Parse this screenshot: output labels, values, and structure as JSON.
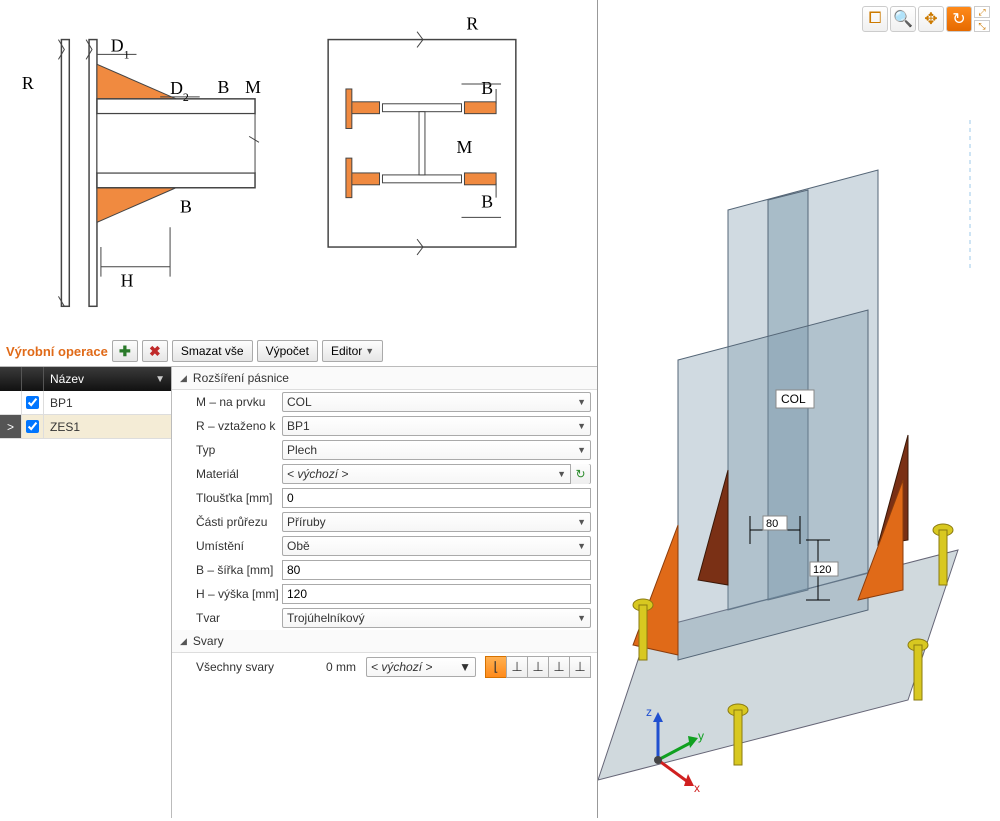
{
  "diagram": {
    "labels": {
      "R1": "R",
      "R2": "R",
      "D1": "D",
      "D1sub": "1",
      "D2": "D",
      "D2sub": "2",
      "M1": "M",
      "M2": "M",
      "B1": "B",
      "B2": "B",
      "B3": "B",
      "B4": "B",
      "H": "H"
    }
  },
  "toolbar": {
    "title": "Výrobní operace",
    "delete_all": "Smazat vše",
    "calc": "Výpočet",
    "editor": "Editor"
  },
  "list": {
    "header": "Název",
    "items": [
      {
        "name": "BP1",
        "checked": true,
        "selected": false
      },
      {
        "name": "ZES1",
        "checked": true,
        "selected": true
      }
    ]
  },
  "section1": {
    "title": "Rozšíření pásnice",
    "rows": {
      "m_label": "M – na prvku",
      "m_val": "COL",
      "r_label": "R – vztaženo k",
      "r_val": "BP1",
      "type_label": "Typ",
      "type_val": "Plech",
      "mat_label": "Materiál",
      "mat_val": "< výchozí >",
      "thick_label": "Tloušťka [mm]",
      "thick_val": "0",
      "parts_label": "Části průřezu",
      "parts_val": "Příruby",
      "pos_label": "Umístění",
      "pos_val": "Obě",
      "b_label": "B – šířka [mm]",
      "b_val": "80",
      "h_label": "H – výška [mm]",
      "h_val": "120",
      "shape_label": "Tvar",
      "shape_val": "Trojúhelníkový"
    }
  },
  "section2": {
    "title": "Svary",
    "all_label": "Všechny svary",
    "val": "0 mm",
    "sel": "< výchozí >"
  },
  "viewport": {
    "label_col": "COL",
    "dim1": "80",
    "dim2": "120",
    "axes": {
      "x": "x",
      "y": "y",
      "z": "z"
    }
  }
}
